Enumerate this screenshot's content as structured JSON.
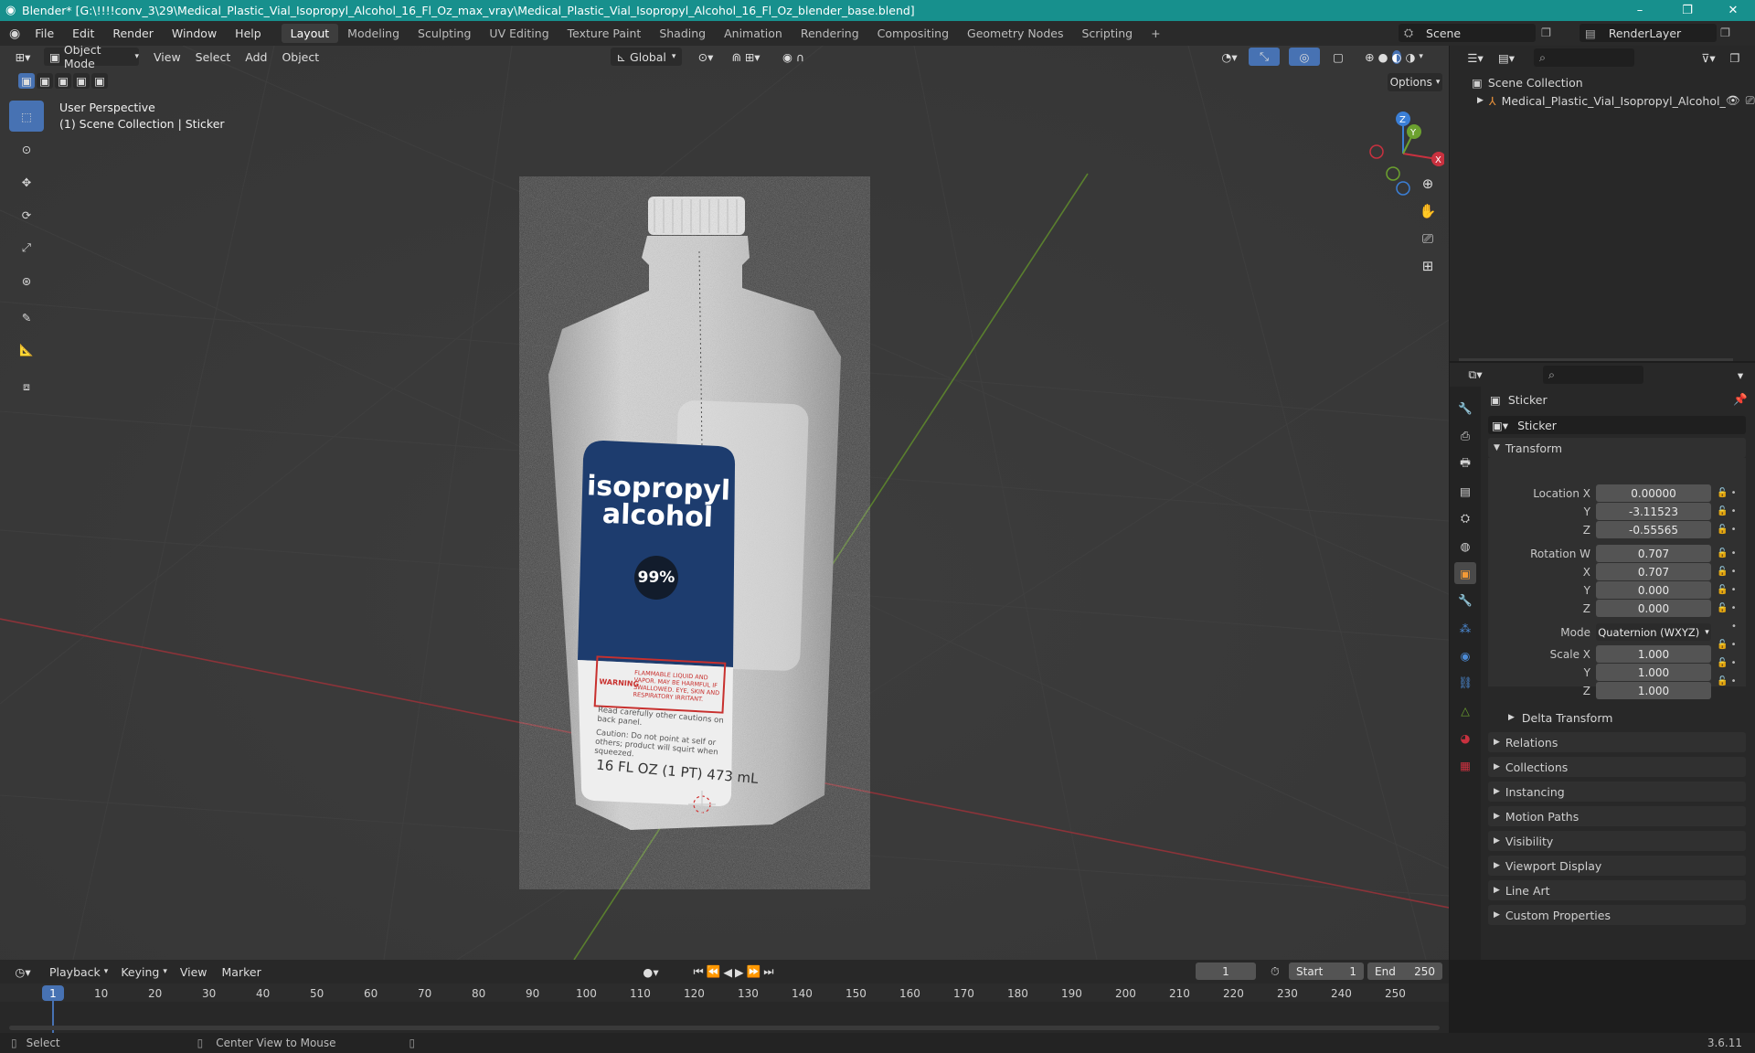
{
  "window": {
    "title": "Blender* [G:\\!!!!conv_3\\29\\Medical_Plastic_Vial_Isopropyl_Alcohol_16_Fl_Oz_max_vray\\Medical_Plastic_Vial_Isopropyl_Alcohol_16_Fl_Oz_blender_base.blend]",
    "minimize": "–",
    "maximize": "❐",
    "close": "✕"
  },
  "menu": {
    "file": "File",
    "edit": "Edit",
    "render": "Render",
    "window": "Window",
    "help": "Help"
  },
  "workspaces": [
    "Layout",
    "Modeling",
    "Sculpting",
    "UV Editing",
    "Texture Paint",
    "Shading",
    "Animation",
    "Rendering",
    "Compositing",
    "Geometry Nodes",
    "Scripting"
  ],
  "workspace_add": "+",
  "scene": {
    "name": "Scene",
    "render_layer": "RenderLayer"
  },
  "viewport": {
    "mode": "Object Mode",
    "view": "View",
    "select": "Select",
    "add": "Add",
    "object": "Object",
    "orientation": "Global",
    "options": "Options",
    "overlay_line1": "User Perspective",
    "overlay_line2": "(1) Scene Collection | Sticker"
  },
  "gizmo": {
    "z": "Z",
    "y": "Y",
    "x": "X"
  },
  "label": {
    "title1": "isopropyl",
    "title2": "alcohol",
    "percent": "99%",
    "warning": "WARNING",
    "warn_text": "FLAMMABLE LIQUID AND VAPOR. MAY BE HARMFUL IF SWALLOWED. EYE, SKIN AND RESPIRATORY IRRITANT.",
    "body1": "Read carefully other cautions on back panel.",
    "body2": "Caution: Do not point at self or others; product will squirt when squeezed.",
    "volume": "16 FL OZ (1 PT) 473 mL"
  },
  "outliner": {
    "root": "Scene Collection",
    "item": "Medical_Plastic_Vial_Isopropyl_Alcohol_"
  },
  "properties": {
    "object_name": "Sticker",
    "data_name": "Sticker",
    "transform": "Transform",
    "location_x_label": "Location X",
    "location_x": "0.00000",
    "location_y_label": "Y",
    "location_y": "-3.11523",
    "location_z_label": "Z",
    "location_z": "-0.55565",
    "rotation_w_label": "Rotation W",
    "rotation_w": "0.707",
    "rotation_x_label": "X",
    "rotation_x": "0.707",
    "rotation_y_label": "Y",
    "rotation_y": "0.000",
    "rotation_z_label": "Z",
    "rotation_z": "0.000",
    "mode_label": "Mode",
    "mode": "Quaternion (WXYZ)",
    "scale_x_label": "Scale X",
    "scale_x": "1.000",
    "scale_y_label": "Y",
    "scale_y": "1.000",
    "scale_z_label": "Z",
    "scale_z": "1.000",
    "delta": "Delta Transform",
    "panels": [
      "Relations",
      "Collections",
      "Instancing",
      "Motion Paths",
      "Visibility",
      "Viewport Display",
      "Line Art",
      "Custom Properties"
    ]
  },
  "timeline": {
    "playback": "Playback",
    "keying": "Keying",
    "view": "View",
    "marker": "Marker",
    "current": "1",
    "start_label": "Start",
    "start": "1",
    "end_label": "End",
    "end": "250",
    "ticks": [
      "10",
      "20",
      "30",
      "40",
      "50",
      "60",
      "70",
      "80",
      "90",
      "100",
      "110",
      "120",
      "130",
      "140",
      "150",
      "160",
      "170",
      "180",
      "190",
      "200",
      "210",
      "220",
      "230",
      "240",
      "250"
    ],
    "frame_marker": "1"
  },
  "status": {
    "select": "Select",
    "center": "Center View to Mouse",
    "version": "3.6.11"
  },
  "colors": {
    "accent": "#4772b3",
    "titlebar": "#17908d",
    "x_axis": "#c9313f",
    "y_axis": "#6ca12f",
    "z_axis": "#3b7fd6",
    "label_blue": "#1d3c6e"
  }
}
